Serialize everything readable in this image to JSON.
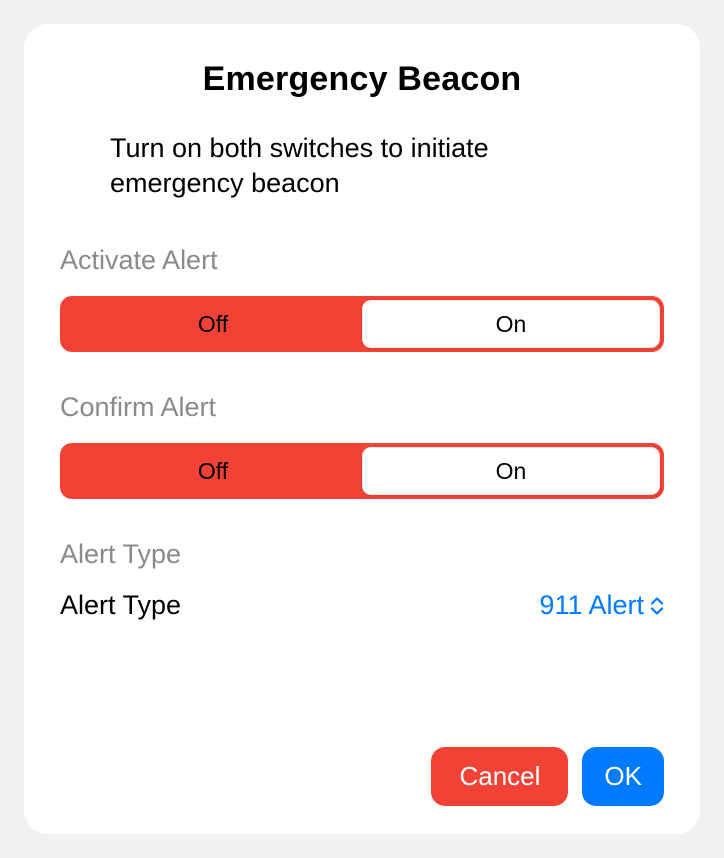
{
  "title": "Emergency Beacon",
  "subtitle": "Turn on both switches to initiate emergency beacon",
  "sections": {
    "activate": {
      "label": "Activate Alert",
      "off": "Off",
      "on": "On",
      "selected": "on"
    },
    "confirm": {
      "label": "Confirm Alert",
      "off": "Off",
      "on": "On",
      "selected": "on"
    },
    "alertType": {
      "sectionLabel": "Alert Type",
      "rowLabel": "Alert Type",
      "value": "911 Alert"
    }
  },
  "buttons": {
    "cancel": "Cancel",
    "ok": "OK"
  },
  "colors": {
    "red": "#f24236",
    "blue": "#007aff",
    "gray": "#8a8a8e"
  }
}
